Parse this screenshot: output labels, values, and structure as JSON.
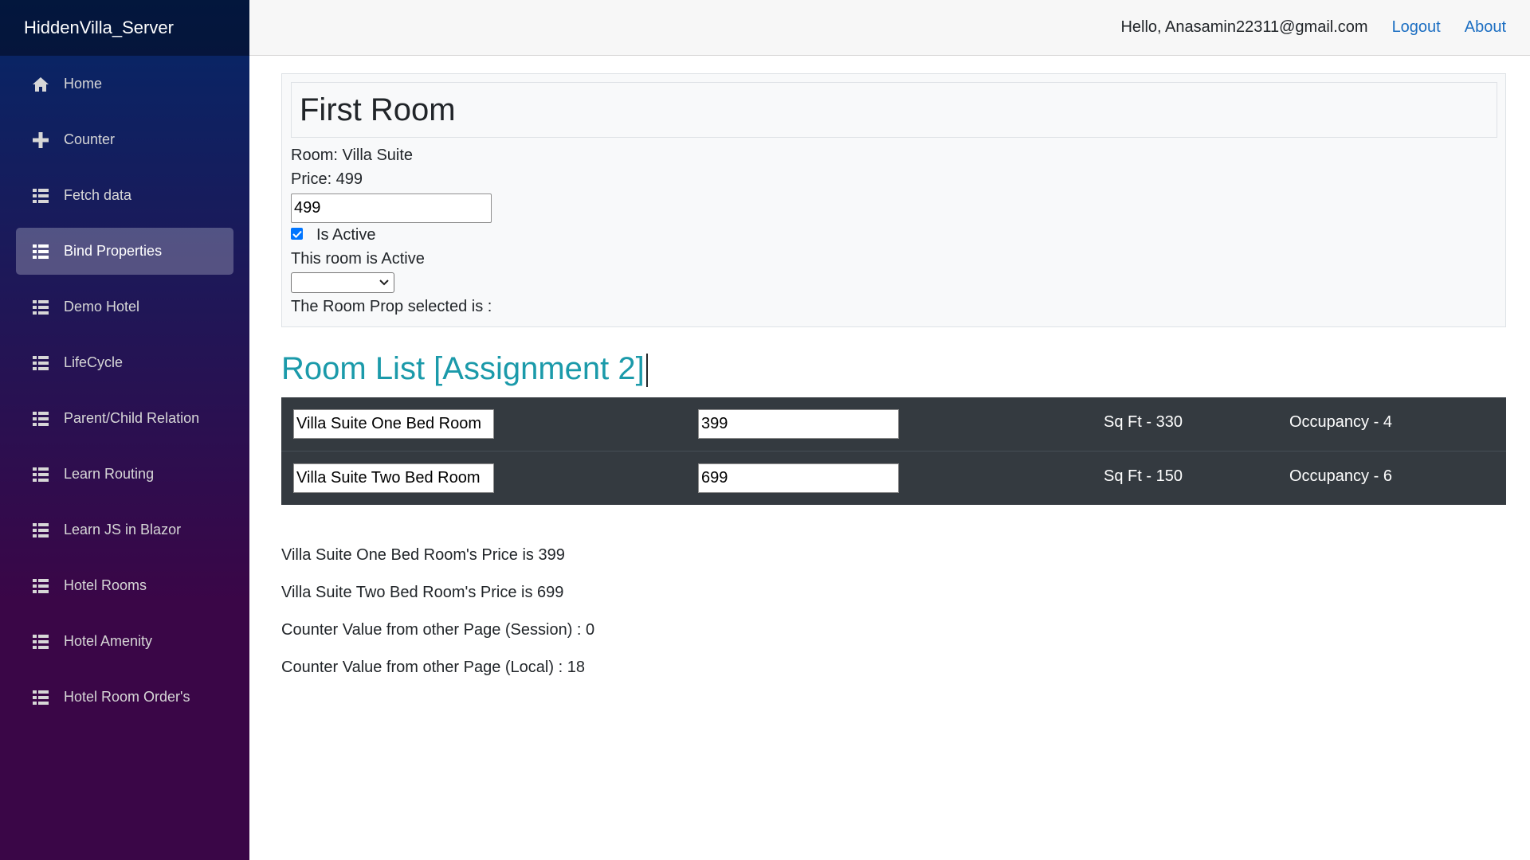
{
  "brand": "HiddenVilla_Server",
  "nav": [
    {
      "label": "Home",
      "icon": "home-icon",
      "active": false
    },
    {
      "label": "Counter",
      "icon": "plus-icon",
      "active": false
    },
    {
      "label": "Fetch data",
      "icon": "list-icon",
      "active": false
    },
    {
      "label": "Bind Properties",
      "icon": "list-icon",
      "active": true
    },
    {
      "label": "Demo Hotel",
      "icon": "list-icon",
      "active": false
    },
    {
      "label": "LifeCycle",
      "icon": "list-icon",
      "active": false
    },
    {
      "label": "Parent/Child Relation",
      "icon": "list-icon",
      "active": false
    },
    {
      "label": "Learn Routing",
      "icon": "list-icon",
      "active": false
    },
    {
      "label": "Learn JS in Blazor",
      "icon": "list-icon",
      "active": false
    },
    {
      "label": "Hotel Rooms",
      "icon": "list-icon",
      "active": false
    },
    {
      "label": "Hotel Amenity",
      "icon": "list-icon",
      "active": false
    },
    {
      "label": "Hotel Room Order's",
      "icon": "list-icon",
      "active": false
    }
  ],
  "topbar": {
    "greeting": "Hello, Anasamin22311@gmail.com",
    "logout": "Logout",
    "about": "About"
  },
  "room": {
    "title": "First Room",
    "room_line": "Room: Villa Suite",
    "price_line": "Price: 499",
    "price_value": "499",
    "is_active_checked": true,
    "is_active_label": "Is Active",
    "status_line": "This room is Active",
    "select_value": "",
    "prop_selected_line": "The Room Prop selected is :"
  },
  "room_list": {
    "title": "Room List [Assignment 2]",
    "rows": [
      {
        "name": "Villa Suite One Bed Room",
        "price": "399",
        "sqft": "Sq Ft - 330",
        "occupancy": "Occupancy - 4"
      },
      {
        "name": "Villa Suite Two Bed Room",
        "price": "699",
        "sqft": "Sq Ft - 150",
        "occupancy": "Occupancy - 6"
      }
    ]
  },
  "summary": [
    "Villa Suite One Bed Room's Price is 399",
    "Villa Suite Two Bed Room's Price is 699",
    "Counter Value from other Page (Session) : 0",
    "Counter Value from other Page (Local) : 18"
  ],
  "colors": {
    "sidebar_top": "#052767",
    "sidebar_bottom": "#3a0647",
    "link": "#1b6ec2",
    "list_title": "#1b9aaa",
    "table_bg": "#343a40"
  }
}
